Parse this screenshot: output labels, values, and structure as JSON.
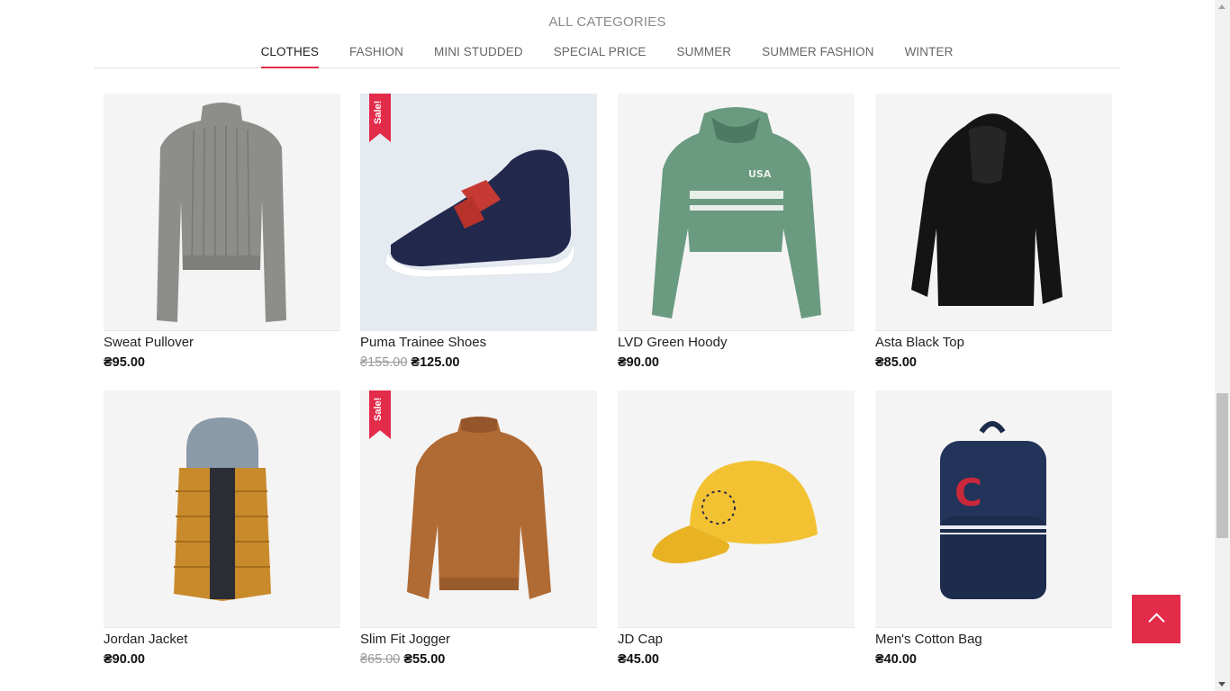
{
  "section": {
    "title": "ALL CATEGORIES"
  },
  "tabs": [
    {
      "label": "CLOTHES",
      "active": true
    },
    {
      "label": "FASHION",
      "active": false
    },
    {
      "label": "MINI STUDDED",
      "active": false
    },
    {
      "label": "SPECIAL PRICE",
      "active": false
    },
    {
      "label": "SUMMER",
      "active": false
    },
    {
      "label": "SUMMER FASHION",
      "active": false
    },
    {
      "label": "WINTER",
      "active": false
    }
  ],
  "products": [
    {
      "name": "Sweat Pullover",
      "price": "₴95.00",
      "image": "sweater-image"
    },
    {
      "name": "Puma Trainee Shoes",
      "old_price": "₴155.00",
      "price": "₴125.00",
      "sale_label": "Sale!",
      "image": "sneaker-image"
    },
    {
      "name": "LVD Green Hoody",
      "price": "₴90.00",
      "image": "green-hoodie-image",
      "image_text": "USA"
    },
    {
      "name": "Asta Black Top",
      "price": "₴85.00",
      "image": "black-hoodie-image"
    },
    {
      "name": "Jordan Jacket",
      "price": "₴90.00",
      "image": "puffer-vest-image"
    },
    {
      "name": "Slim Fit Jogger",
      "old_price": "₴65.00",
      "price": "₴55.00",
      "sale_label": "Sale!",
      "image": "brown-sweatshirt-image"
    },
    {
      "name": "JD Cap",
      "price": "₴45.00",
      "image": "yellow-cap-image"
    },
    {
      "name": "Men's Cotton Bag",
      "price": "₴40.00",
      "image": "backpack-image",
      "image_text": "C"
    }
  ],
  "colors": {
    "accent": "#e32b4a"
  },
  "back_to_top": {
    "icon": "chevron-up-icon"
  }
}
